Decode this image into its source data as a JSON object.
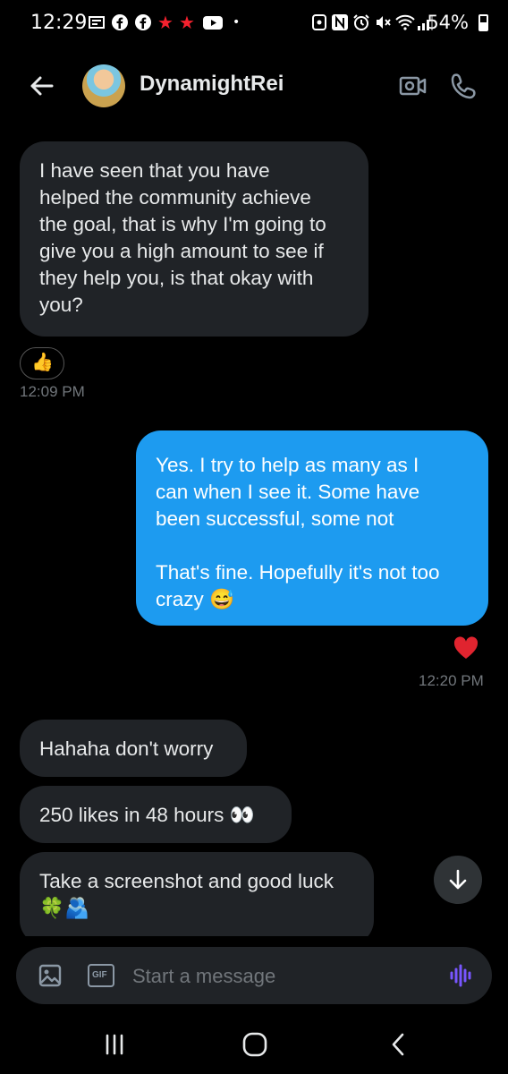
{
  "status_bar": {
    "time": "12:29",
    "battery": "54%",
    "battery_level": 0.54
  },
  "header": {
    "contact_name": "DynamightRei"
  },
  "messages": [
    {
      "lines": [
        "I have seen that you have",
        "helped the community achieve",
        "the goal, that is why I'm going to",
        "give you a high amount to see if",
        "they help you, is that okay with",
        "you?"
      ],
      "reaction": "👍",
      "time": "12:09 PM"
    },
    {
      "lines": [
        "Yes. I try to help as many as I",
        "can when I see it. Some have",
        "been successful, some not",
        "",
        "That's fine. Hopefully it's not too",
        "crazy 😅"
      ],
      "reaction": "❤️",
      "time": "12:20 PM"
    },
    {
      "lines": [
        "Hahaha don't worry"
      ]
    },
    {
      "lines": [
        "250 likes in 48 hours 👀"
      ]
    },
    {
      "lines": [
        "Take a screenshot and good luck",
        "🍀🫂"
      ]
    }
  ],
  "composer": {
    "placeholder": "Start a message",
    "gif_label": "GIF"
  },
  "colors": {
    "background": "#000000",
    "received_bubble": "#202327",
    "sent_bubble": "#1d9bf0",
    "text": "#e7e9ea",
    "muted": "#71767b",
    "heart": "#f4212e",
    "mic_accent": "#7856ff"
  }
}
